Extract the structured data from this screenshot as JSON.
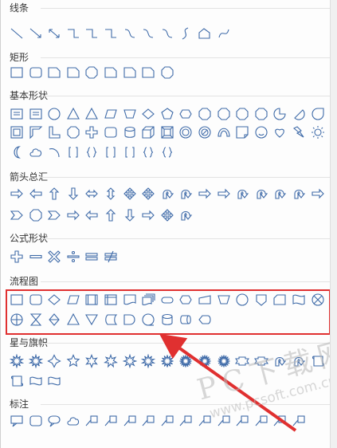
{
  "shape_gallery": {
    "sections": [
      {
        "id": "lines",
        "title": "线条",
        "icons": [
          "line-icon",
          "arrow-line-icon",
          "double-arrow-line-icon",
          "elbow-connector-icon",
          "elbow-arrow-connector-icon",
          "elbow-double-arrow-connector-icon",
          "curved-connector-icon",
          "curved-arrow-connector-icon",
          "curved-double-arrow-connector-icon",
          "curve-icon",
          "freeform-icon",
          "scribble-icon"
        ]
      },
      {
        "id": "rectangles",
        "title": "矩形",
        "icons": [
          "rectangle-icon",
          "rounded-rectangle-icon",
          "snip-single-corner-rectangle-icon",
          "snip-same-side-corner-rectangle-icon",
          "snip-diagonal-corner-rectangle-icon",
          "snip-round-rectangle-icon",
          "round-single-corner-rectangle-icon",
          "round-same-side-corner-rectangle-icon",
          "round-diagonal-corner-rectangle-icon"
        ]
      },
      {
        "id": "basic",
        "title": "基本形状",
        "icons": [
          "text-box-icon",
          "vertical-text-box-icon",
          "oval-icon",
          "triangle-icon",
          "right-triangle-icon",
          "parallelogram-icon",
          "trapezoid-icon",
          "diamond-icon",
          "pentagon-icon",
          "hexagon-icon",
          "heptagon-icon",
          "octagon-icon",
          "decagon-icon",
          "dodecagon-icon",
          "pie-icon",
          "chord-icon",
          "teardrop-icon",
          "frame-icon",
          "half-frame-icon",
          "l-shape-icon",
          "diagonal-stripe-icon",
          "cross-icon",
          "plaque-icon",
          "can-icon",
          "cube-icon",
          "bevel-icon",
          "donut-icon",
          "no-symbol-icon",
          "block-arc-icon",
          "folded-corner-icon",
          "smiley-face-icon",
          "heart-icon",
          "lightning-bolt-icon",
          "sun-icon",
          "moon-icon",
          "cloud-icon",
          "arc-icon",
          "double-bracket-icon",
          "double-brace-icon",
          "left-bracket-icon",
          "right-bracket-icon",
          "left-brace-icon",
          "right-brace-icon"
        ]
      },
      {
        "id": "block_arrows",
        "title": "箭头总汇",
        "icons": [
          "right-arrow-icon",
          "left-arrow-icon",
          "up-arrow-icon",
          "down-arrow-icon",
          "left-right-arrow-icon",
          "up-down-arrow-icon",
          "quad-arrow-icon",
          "left-right-up-arrow-icon",
          "bent-arrow-icon",
          "u-turn-arrow-icon",
          "left-up-arrow-icon",
          "bent-up-arrow-icon",
          "curved-right-arrow-icon",
          "curved-left-arrow-icon",
          "curved-up-arrow-icon",
          "curved-down-arrow-icon",
          "striped-right-arrow-icon",
          "notched-right-arrow-icon",
          "pentagon-arrow-icon",
          "chevron-icon",
          "right-arrow-callout-icon",
          "left-arrow-callout-icon",
          "up-arrow-callout-icon",
          "down-arrow-callout-icon",
          "left-right-arrow-callout-icon",
          "quad-arrow-callout-icon",
          "circular-arrow-icon"
        ]
      },
      {
        "id": "equation",
        "title": "公式形状",
        "icons": [
          "plus-icon",
          "minus-icon",
          "multiply-icon",
          "division-icon",
          "equal-icon",
          "not-equal-icon"
        ]
      },
      {
        "id": "flowchart",
        "title": "流程图",
        "icons": [
          "flowchart-process-icon",
          "flowchart-alternate-process-icon",
          "flowchart-decision-icon",
          "flowchart-data-icon",
          "flowchart-predefined-process-icon",
          "flowchart-internal-storage-icon",
          "flowchart-document-icon",
          "flowchart-multidocument-icon",
          "flowchart-terminator-icon",
          "flowchart-preparation-icon",
          "flowchart-manual-input-icon",
          "flowchart-manual-operation-icon",
          "flowchart-connector-icon",
          "flowchart-off-page-connector-icon",
          "flowchart-card-icon",
          "flowchart-punched-tape-icon",
          "flowchart-summing-junction-icon",
          "flowchart-or-icon",
          "flowchart-collate-icon",
          "flowchart-sort-icon",
          "flowchart-extract-icon",
          "flowchart-merge-icon",
          "flowchart-stored-data-icon",
          "flowchart-delay-icon",
          "flowchart-sequential-access-storage-icon",
          "flowchart-magnetic-disk-icon",
          "flowchart-direct-access-storage-icon",
          "flowchart-display-icon"
        ]
      },
      {
        "id": "stars",
        "title": "星与旗帜",
        "icons": [
          "explosion-1-icon",
          "explosion-2-icon",
          "star-4-point-icon",
          "star-5-point-icon",
          "star-6-point-icon",
          "star-7-point-icon",
          "star-8-point-icon",
          "star-10-point-icon",
          "star-12-point-icon",
          "star-16-point-icon",
          "star-24-point-icon",
          "star-32-point-icon",
          "ribbon-up-icon",
          "ribbon-down-icon",
          "curved-ribbon-up-icon",
          "curved-ribbon-down-icon",
          "vertical-scroll-icon",
          "horizontal-scroll-icon",
          "wave-icon",
          "double-wave-icon"
        ]
      },
      {
        "id": "callouts",
        "title": "标注",
        "icons": [
          "rectangular-callout-icon",
          "rounded-rectangular-callout-icon",
          "oval-callout-icon",
          "cloud-callout-icon",
          "line-callout-1-icon",
          "line-callout-2-icon",
          "line-callout-3-icon",
          "line-callout-4-icon",
          "line-callout-1-accent-bar-icon",
          "line-callout-2-accent-bar-icon",
          "line-callout-3-accent-bar-icon",
          "line-callout-4-accent-bar-icon",
          "line-callout-1-no-border-icon",
          "line-callout-2-no-border-icon",
          "line-callout-3-no-border-icon",
          "line-callout-4-no-border-icon"
        ]
      }
    ]
  },
  "highlight": {
    "color": "#e03030"
  },
  "watermark": {
    "line1": "PC下载网",
    "line2": "www.pcsoft.com.cn"
  },
  "colors": {
    "shape_stroke": "#3e6aa8",
    "shape_fill": "#ffffff",
    "header_text": "#333333",
    "divider": "#e3e3e3"
  }
}
